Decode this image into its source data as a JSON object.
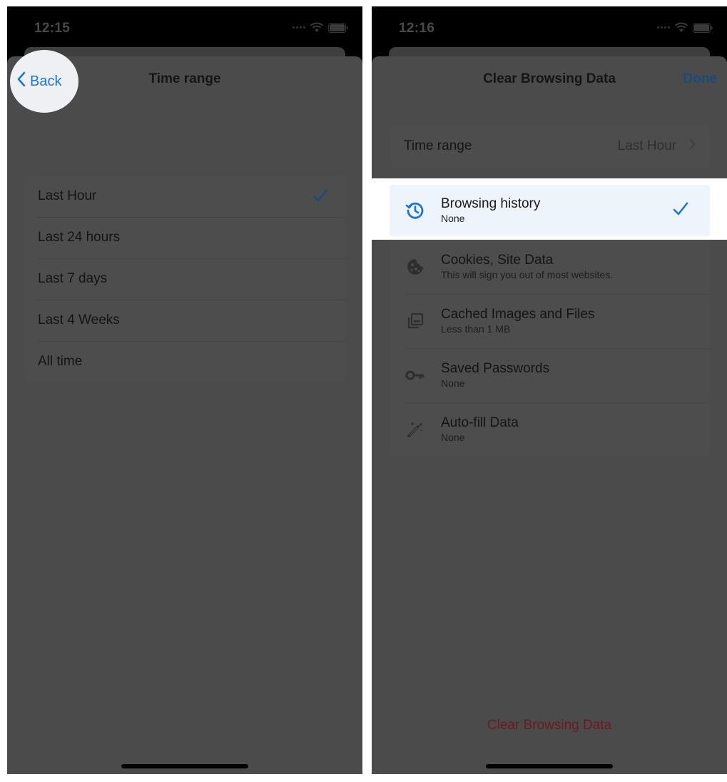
{
  "left": {
    "status": {
      "time": "12:15"
    },
    "nav": {
      "back_label": "Back",
      "title": "Time range"
    },
    "options": [
      {
        "label": "Last Hour",
        "selected": true
      },
      {
        "label": "Last 24 hours",
        "selected": false
      },
      {
        "label": "Last 7 days",
        "selected": false
      },
      {
        "label": "Last 4 Weeks",
        "selected": false
      },
      {
        "label": "All time",
        "selected": false
      }
    ]
  },
  "right": {
    "status": {
      "time": "12:16"
    },
    "nav": {
      "title": "Clear Browsing Data",
      "done_label": "Done"
    },
    "time_range": {
      "label": "Time range",
      "value": "Last Hour"
    },
    "items": [
      {
        "icon": "history-icon",
        "title": "Browsing history",
        "subtitle": "None",
        "checked": true,
        "highlighted": true
      },
      {
        "icon": "cookie-icon",
        "title": "Cookies, Site Data",
        "subtitle": "This will sign you out of most websites.",
        "checked": false
      },
      {
        "icon": "images-icon",
        "title": "Cached Images and Files",
        "subtitle": "Less than 1 MB",
        "checked": false
      },
      {
        "icon": "key-icon",
        "title": "Saved Passwords",
        "subtitle": "None",
        "checked": false
      },
      {
        "icon": "magic-wand-icon",
        "title": "Auto-fill Data",
        "subtitle": "None",
        "checked": false
      }
    ],
    "clear_button_label": "Clear Browsing Data"
  },
  "colors": {
    "accent": "#1f75d2",
    "dimmed_accent": "#1b4a7c",
    "destructive_dimmed": "#6b1a1f",
    "highlight_bg": "#eef4fb"
  }
}
